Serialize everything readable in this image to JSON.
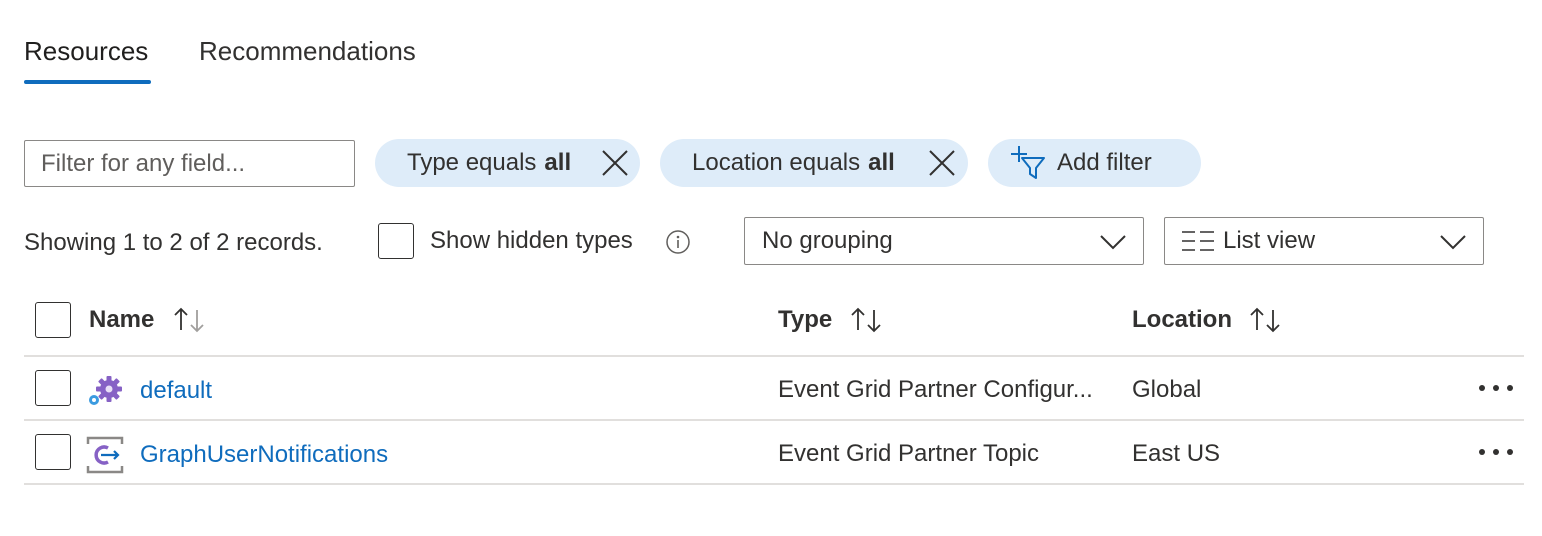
{
  "tabs": [
    {
      "label": "Resources",
      "active": true
    },
    {
      "label": "Recommendations",
      "active": false
    }
  ],
  "filter": {
    "placeholder": "Filter for any field...",
    "value": ""
  },
  "pills": [
    {
      "prefix": "Type equals",
      "value": "all"
    },
    {
      "prefix": "Location equals",
      "value": "all"
    }
  ],
  "add_filter_label": "Add filter",
  "summary_text": "Showing 1 to 2 of 2 records.",
  "show_hidden_types_label": "Show hidden types",
  "grouping": {
    "selected": "No grouping"
  },
  "view": {
    "selected": "List view"
  },
  "table": {
    "columns": [
      "Name",
      "Type",
      "Location"
    ],
    "rows": [
      {
        "name": "default",
        "type": "Event Grid Partner Configur...",
        "location": "Global",
        "icon": "partner-configuration-icon"
      },
      {
        "name": "GraphUserNotifications",
        "type": "Event Grid Partner Topic",
        "location": "East US",
        "icon": "partner-topic-icon"
      }
    ]
  },
  "colors": {
    "accent": "#0f6cbd",
    "pill_bg": "#deecf9",
    "text": "#323130",
    "divider": "#e1dfdd"
  }
}
